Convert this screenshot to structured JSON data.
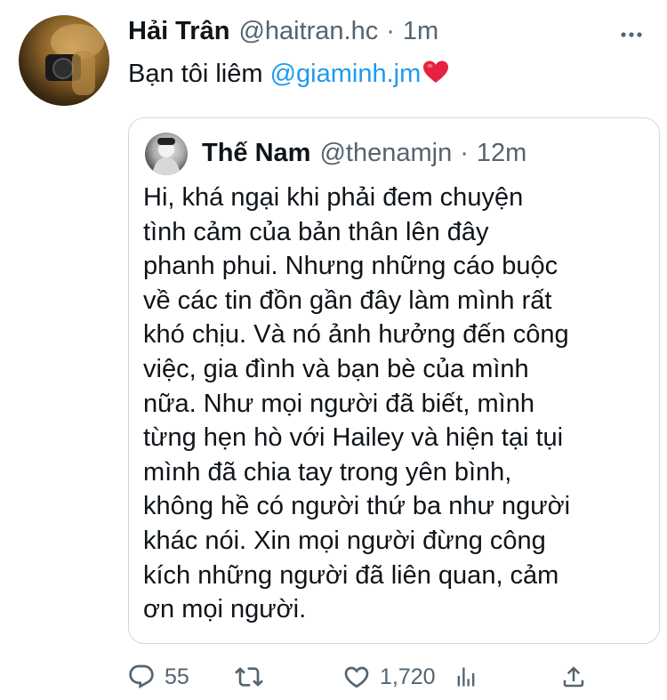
{
  "tweet": {
    "author_name": "Hải Trân",
    "author_handle": "@haitran.hc",
    "separator": "·",
    "time": "1m",
    "text_prefix": "Bạn tôi liêm ",
    "mention": "@giaminh.jm",
    "emoji": "heart"
  },
  "quote": {
    "author_name": "Thế Nam",
    "author_handle": "@thenamjn",
    "separator": "·",
    "time": "12m",
    "lines": [
      "Hi, khá ngại khi phải đem chuyện",
      "tình cảm của bản thân lên đây",
      "phanh phui. Nhưng những cáo buộc",
      "về các tin đồn gần đây làm mình rất",
      "khó chịu. Và nó ảnh hưởng đến công",
      "việc, gia đình và bạn bè của mình",
      "nữa. Như mọi người đã biết, mình",
      "từng hẹn hò với Hailey và hiện tại tụi",
      "mình đã chia tay trong yên bình,",
      "không hề có người thứ ba như người",
      "khác nói. Xin mọi người đừng công",
      "kích những người đã liên quan, cảm",
      "ơn mọi người."
    ]
  },
  "actions": {
    "reply_count": "55",
    "retweet_count": "",
    "like_count": "1,720"
  },
  "icons": {
    "more": "more-icon",
    "reply": "reply-icon",
    "retweet": "retweet-icon",
    "like": "heart-icon",
    "analytics": "analytics-icon",
    "share": "share-icon"
  },
  "colors": {
    "text": "#0f1419",
    "secondary": "#536471",
    "link": "#1d9bf0",
    "heart_emoji": "#e5223f",
    "border": "#cfd9de"
  }
}
